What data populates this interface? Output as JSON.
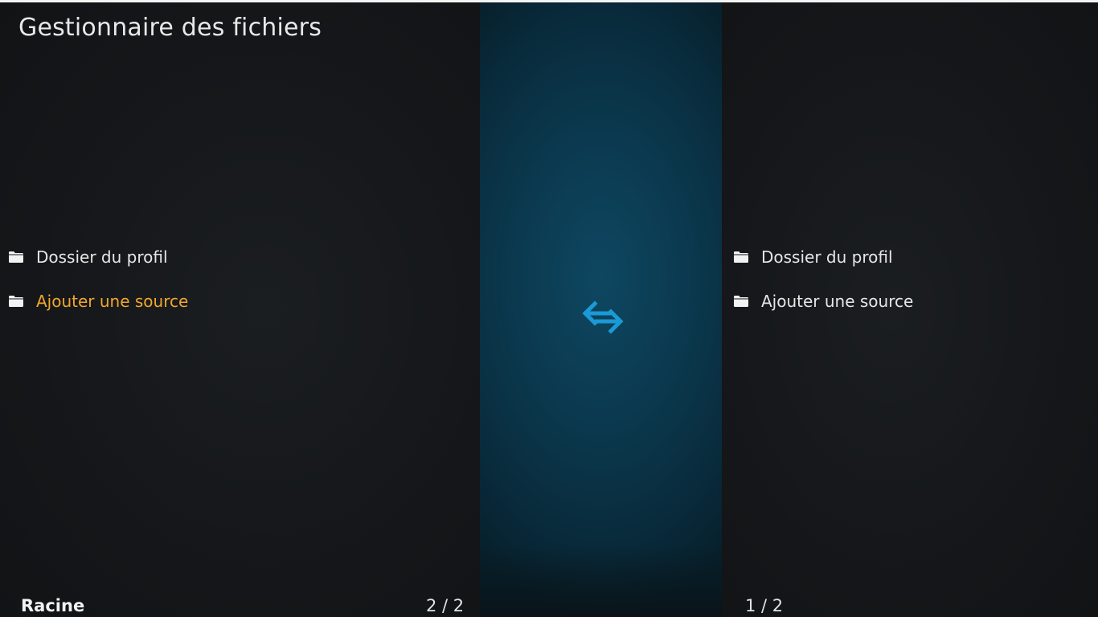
{
  "window": {
    "title": "Gestionnaire des fichiers"
  },
  "left_pane": {
    "items": [
      {
        "label": "Dossier du profil",
        "icon": "folder-icon",
        "focused": false
      },
      {
        "label": "Ajouter une source",
        "icon": "folder-icon",
        "focused": true
      }
    ],
    "footer_path": "Racine",
    "footer_count": "2 / 2"
  },
  "right_pane": {
    "items": [
      {
        "label": "Dossier du profil",
        "icon": "folder-icon",
        "focused": false
      },
      {
        "label": "Ajouter une source",
        "icon": "folder-icon",
        "focused": false
      }
    ],
    "footer_count": "1 / 2"
  },
  "center": {
    "icon": "swap-arrows-icon"
  },
  "colors": {
    "focused_text": "#f0a72d",
    "accent_blue": "#1a9ad6",
    "divider_blue": "#0b3a50"
  }
}
